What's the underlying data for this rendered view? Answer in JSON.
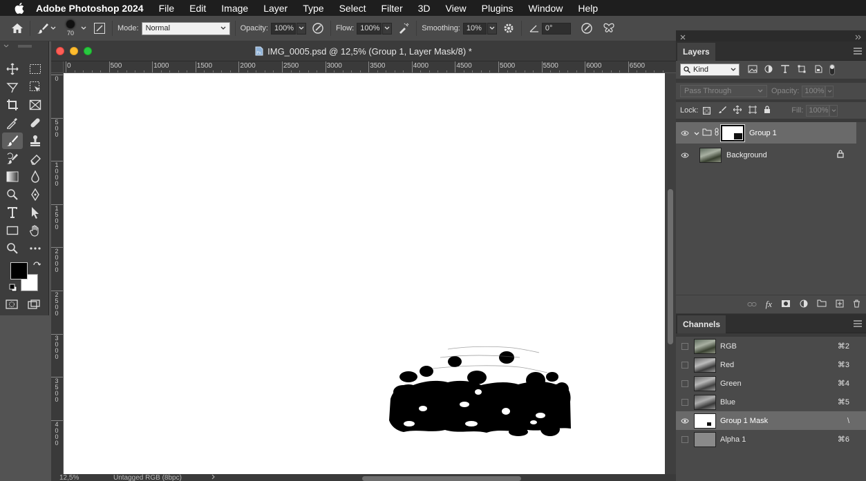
{
  "menubar": {
    "app_name": "Adobe Photoshop 2024",
    "items": [
      "File",
      "Edit",
      "Image",
      "Layer",
      "Type",
      "Select",
      "Filter",
      "3D",
      "View",
      "Plugins",
      "Window",
      "Help"
    ]
  },
  "options": {
    "brush_size": "70",
    "mode_label": "Mode:",
    "mode_value": "Normal",
    "opacity_label": "Opacity:",
    "opacity_value": "100%",
    "flow_label": "Flow:",
    "flow_value": "100%",
    "smoothing_label": "Smoothing:",
    "smoothing_value": "10%",
    "angle_value": "0°"
  },
  "document": {
    "title": "IMG_0005.psd @ 12,5% (Group 1, Layer Mask/8) *",
    "ruler_top_ticks": [
      "0",
      "500",
      "1000",
      "1500",
      "2000",
      "2500",
      "3000",
      "3500",
      "4000",
      "4500",
      "5000",
      "5500",
      "6000",
      "6500"
    ],
    "ruler_left_ticks": [
      "0",
      "500",
      "1000",
      "1500",
      "2000",
      "2500",
      "3000",
      "3500",
      "4000"
    ],
    "status_zoom": "12,5%",
    "status_profile": "Untagged RGB (8bpc)"
  },
  "layers_panel": {
    "tab": "Layers",
    "filter_kind": "Kind",
    "blend_mode": "Pass Through",
    "opacity_label": "Opacity:",
    "opacity_value": "100%",
    "lock_label": "Lock:",
    "fill_label": "Fill:",
    "fill_value": "100%",
    "layers": [
      {
        "name": "Group 1",
        "selected": true
      },
      {
        "name": "Background",
        "selected": false
      }
    ]
  },
  "channels_panel": {
    "tab": "Channels",
    "channels": [
      {
        "name": "RGB",
        "shortcut": "⌘2",
        "visible": false
      },
      {
        "name": "Red",
        "shortcut": "⌘3",
        "visible": false
      },
      {
        "name": "Green",
        "shortcut": "⌘4",
        "visible": false
      },
      {
        "name": "Blue",
        "shortcut": "⌘5",
        "visible": false
      },
      {
        "name": "Group 1 Mask",
        "shortcut": "\\",
        "visible": true
      },
      {
        "name": "Alpha 1",
        "shortcut": "⌘6",
        "visible": false
      }
    ]
  },
  "colors": {
    "foreground": "#000000",
    "background": "#ffffff",
    "selected_row": "#6a6a6a"
  }
}
